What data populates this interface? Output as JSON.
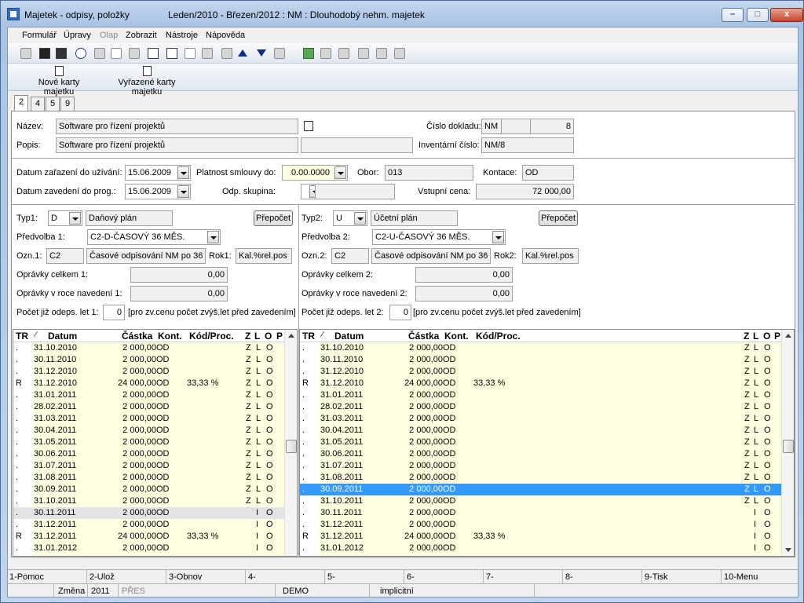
{
  "window": {
    "title": "Majetek - odpisy, položky",
    "info": "Leden/2010 - Březen/2012 : NM : Dlouhodobý nehm. majetek",
    "min": "–",
    "max": "□",
    "close": "x"
  },
  "menu": [
    "Formulář",
    "Úpravy",
    "Olap",
    "Zobrazit",
    "Nástroje",
    "Nápověda"
  ],
  "commands": [
    "Nové karty majetku",
    "Vyřazené karty majetku"
  ],
  "tabs": [
    "2",
    "4",
    "5",
    "9"
  ],
  "header": {
    "nazev_label": "Název:",
    "nazev": "Software pro řízení projektů",
    "popis_label": "Popis:",
    "popis": "Software pro řízení projektů",
    "popis2": "",
    "cislo_label": "Číslo dokladu:",
    "cislo_rada": "NM",
    "cislo_mid": "",
    "cislo_num": "8",
    "inv_label": "Inventární číslo:",
    "inv": "NM/8"
  },
  "dates": {
    "zarazeni_label": "Datum zařazení do užívání:",
    "zarazeni": "15.06.2009",
    "zavedeni_label": "Datum zavedení do prog.:",
    "zavedeni": "15.06.2009",
    "platnost_label": "Platnost smlouvy do:",
    "platnost": "0.00.0000",
    "skupina_label": "Odp. skupina:",
    "skupina": "",
    "skupina_name": "",
    "obor_label": "Obor:",
    "obor": "013",
    "kontace_label": "Kontace:",
    "kontace": "OD",
    "vstupni_label": "Vstupní cena:",
    "vstupni": "72 000,00"
  },
  "left": {
    "typ_label": "Typ1:",
    "typ": "D",
    "typ_name": "Daňový plán",
    "prepocet": "Přepočet",
    "predvolba_label": "Předvolba 1:",
    "predvolba": "C2-D-ČASOVÝ 36 MĚS.",
    "ozn_label": "Ozn.1:",
    "ozn": "C2",
    "ozn_name": "Časové odpisování NM po 36 m",
    "rok_label": "Rok1:",
    "rok": "Kal.%rel.pos",
    "opr_celkem_label": "Oprávky celkem 1:",
    "opr_celkem": "0,00",
    "opr_roce_label": "Oprávky v roce navedení 1:",
    "opr_roce": "0,00",
    "pocet_label": "Počet již odeps. let 1:",
    "pocet": "0",
    "pocet_note": "[pro zv.cenu počet zvýš.let před zavedením]"
  },
  "right": {
    "typ_label": "Typ2:",
    "typ": "U",
    "typ_name": "Účetní plán",
    "prepocet": "Přepočet",
    "predvolba_label": "Předvolba 2:",
    "predvolba": "C2-U-ČASOVÝ 36 MĚS.",
    "ozn_label": "Ozn.2:",
    "ozn": "C2",
    "ozn_name": "Časové odpisování NM po 36 m",
    "rok_label": "Rok2:",
    "rok": "Kal.%rel.pos",
    "opr_celkem_label": "Oprávky celkem 2:",
    "opr_celkem": "0,00",
    "opr_roce_label": "Oprávky v roce navedení 2:",
    "opr_roce": "0,00",
    "pocet_label": "Počet již odeps. let 2:",
    "pocet": "0",
    "pocet_note": "[pro zv.cenu počet zvýš.let před zavedením]"
  },
  "grid_headers": {
    "tr": "TR",
    "sort": "⁄",
    "datum": "Datum",
    "castka": "Částka",
    "kont": "Kont.",
    "kod": "Kód/Proc.",
    "z": "Z",
    "l": "L",
    "o": "O",
    "p": "P"
  },
  "grid_left": [
    {
      "tr": ".",
      "datum": "31.10.2010",
      "castka": "2 000,00",
      "kont": "OD",
      "kod": "",
      "z": "Z",
      "l": "L",
      "o": "O"
    },
    {
      "tr": ".",
      "datum": "30.11.2010",
      "castka": "2 000,00",
      "kont": "OD",
      "kod": "",
      "z": "Z",
      "l": "L",
      "o": "O"
    },
    {
      "tr": ".",
      "datum": "31.12.2010",
      "castka": "2 000,00",
      "kont": "OD",
      "kod": "",
      "z": "Z",
      "l": "L",
      "o": "O"
    },
    {
      "tr": "R",
      "datum": "31.12.2010",
      "castka": "24 000,00",
      "kont": "OD",
      "kod": "33,33 %",
      "z": "Z",
      "l": "L",
      "o": "O"
    },
    {
      "tr": ".",
      "datum": "31.01.2011",
      "castka": "2 000,00",
      "kont": "OD",
      "kod": "",
      "z": "Z",
      "l": "L",
      "o": "O"
    },
    {
      "tr": ".",
      "datum": "28.02.2011",
      "castka": "2 000,00",
      "kont": "OD",
      "kod": "",
      "z": "Z",
      "l": "L",
      "o": "O"
    },
    {
      "tr": ".",
      "datum": "31.03.2011",
      "castka": "2 000,00",
      "kont": "OD",
      "kod": "",
      "z": "Z",
      "l": "L",
      "o": "O"
    },
    {
      "tr": ".",
      "datum": "30.04.2011",
      "castka": "2 000,00",
      "kont": "OD",
      "kod": "",
      "z": "Z",
      "l": "L",
      "o": "O"
    },
    {
      "tr": ".",
      "datum": "31.05.2011",
      "castka": "2 000,00",
      "kont": "OD",
      "kod": "",
      "z": "Z",
      "l": "L",
      "o": "O"
    },
    {
      "tr": ".",
      "datum": "30.06.2011",
      "castka": "2 000,00",
      "kont": "OD",
      "kod": "",
      "z": "Z",
      "l": "L",
      "o": "O"
    },
    {
      "tr": ".",
      "datum": "31.07.2011",
      "castka": "2 000,00",
      "kont": "OD",
      "kod": "",
      "z": "Z",
      "l": "L",
      "o": "O"
    },
    {
      "tr": ".",
      "datum": "31.08.2011",
      "castka": "2 000,00",
      "kont": "OD",
      "kod": "",
      "z": "Z",
      "l": "L",
      "o": "O"
    },
    {
      "tr": ".",
      "datum": "30.09.2011",
      "castka": "2 000,00",
      "kont": "OD",
      "kod": "",
      "z": "Z",
      "l": "L",
      "o": "O"
    },
    {
      "tr": ".",
      "datum": "31.10.2011",
      "castka": "2 000,00",
      "kont": "OD",
      "kod": "",
      "z": "Z",
      "l": "L",
      "o": "O"
    },
    {
      "tr": ".",
      "datum": "30.11.2011",
      "castka": "2 000,00",
      "kont": "OD",
      "kod": "",
      "z": "",
      "l": "I",
      "o": "O"
    },
    {
      "tr": ".",
      "datum": "31.12.2011",
      "castka": "2 000,00",
      "kont": "OD",
      "kod": "",
      "z": "",
      "l": "I",
      "o": "O"
    },
    {
      "tr": "R",
      "datum": "31.12.2011",
      "castka": "24 000,00",
      "kont": "OD",
      "kod": "33,33 %",
      "z": "",
      "l": "I",
      "o": "O"
    },
    {
      "tr": ".",
      "datum": "31.01.2012",
      "castka": "2 000,00",
      "kont": "OD",
      "kod": "",
      "z": "",
      "l": "I",
      "o": "O"
    }
  ],
  "grid_right": [
    {
      "tr": ".",
      "datum": "31.10.2010",
      "castka": "2 000,00",
      "kont": "OD",
      "kod": "",
      "z": "Z",
      "l": "L",
      "o": "O"
    },
    {
      "tr": ".",
      "datum": "30.11.2010",
      "castka": "2 000,00",
      "kont": "OD",
      "kod": "",
      "z": "Z",
      "l": "L",
      "o": "O"
    },
    {
      "tr": ".",
      "datum": "31.12.2010",
      "castka": "2 000,00",
      "kont": "OD",
      "kod": "",
      "z": "Z",
      "l": "L",
      "o": "O"
    },
    {
      "tr": "R",
      "datum": "31.12.2010",
      "castka": "24 000,00",
      "kont": "OD",
      "kod": "33,33 %",
      "z": "Z",
      "l": "L",
      "o": "O"
    },
    {
      "tr": ".",
      "datum": "31.01.2011",
      "castka": "2 000,00",
      "kont": "OD",
      "kod": "",
      "z": "Z",
      "l": "L",
      "o": "O"
    },
    {
      "tr": ".",
      "datum": "28.02.2011",
      "castka": "2 000,00",
      "kont": "OD",
      "kod": "",
      "z": "Z",
      "l": "L",
      "o": "O"
    },
    {
      "tr": ".",
      "datum": "31.03.2011",
      "castka": "2 000,00",
      "kont": "OD",
      "kod": "",
      "z": "Z",
      "l": "L",
      "o": "O"
    },
    {
      "tr": ".",
      "datum": "30.04.2011",
      "castka": "2 000,00",
      "kont": "OD",
      "kod": "",
      "z": "Z",
      "l": "L",
      "o": "O"
    },
    {
      "tr": ".",
      "datum": "31.05.2011",
      "castka": "2 000,00",
      "kont": "OD",
      "kod": "",
      "z": "Z",
      "l": "L",
      "o": "O"
    },
    {
      "tr": ".",
      "datum": "30.06.2011",
      "castka": "2 000,00",
      "kont": "OD",
      "kod": "",
      "z": "Z",
      "l": "L",
      "o": "O"
    },
    {
      "tr": ".",
      "datum": "31.07.2011",
      "castka": "2 000,00",
      "kont": "OD",
      "kod": "",
      "z": "Z",
      "l": "L",
      "o": "O"
    },
    {
      "tr": ".",
      "datum": "31.08.2011",
      "castka": "2 000,00",
      "kont": "OD",
      "kod": "",
      "z": "Z",
      "l": "L",
      "o": "O"
    },
    {
      "tr": ".",
      "datum": "30.09.2011",
      "castka": "2 000,00",
      "kont": "OD",
      "kod": "",
      "z": "Z",
      "l": "L",
      "o": "O"
    },
    {
      "tr": ".",
      "datum": "31.10.2011",
      "castka": "2 000,00",
      "kont": "OD",
      "kod": "",
      "z": "Z",
      "l": "L",
      "o": "O"
    },
    {
      "tr": ".",
      "datum": "30.11.2011",
      "castka": "2 000,00",
      "kont": "OD",
      "kod": "",
      "z": "",
      "l": "I",
      "o": "O"
    },
    {
      "tr": ".",
      "datum": "31.12.2011",
      "castka": "2 000,00",
      "kont": "OD",
      "kod": "",
      "z": "",
      "l": "I",
      "o": "O"
    },
    {
      "tr": "R",
      "datum": "31.12.2011",
      "castka": "24 000,00",
      "kont": "OD",
      "kod": "33,33 %",
      "z": "",
      "l": "I",
      "o": "O"
    },
    {
      "tr": ".",
      "datum": "31.01.2012",
      "castka": "2 000,00",
      "kont": "OD",
      "kod": "",
      "z": "",
      "l": "I",
      "o": "O"
    }
  ],
  "left_highlight_row": 14,
  "right_selected_row": 12,
  "fkeys": [
    "1-Pomoc",
    "2-Ulož",
    "3-Obnov",
    "4-",
    "5-",
    "6-",
    "7-",
    "8-",
    "9-Tisk",
    "10-Menu"
  ],
  "status": {
    "zmena": "Změna",
    "rok": "2011",
    "mode": "PŘES",
    "db": "DEMO",
    "profile": "implicitní"
  }
}
